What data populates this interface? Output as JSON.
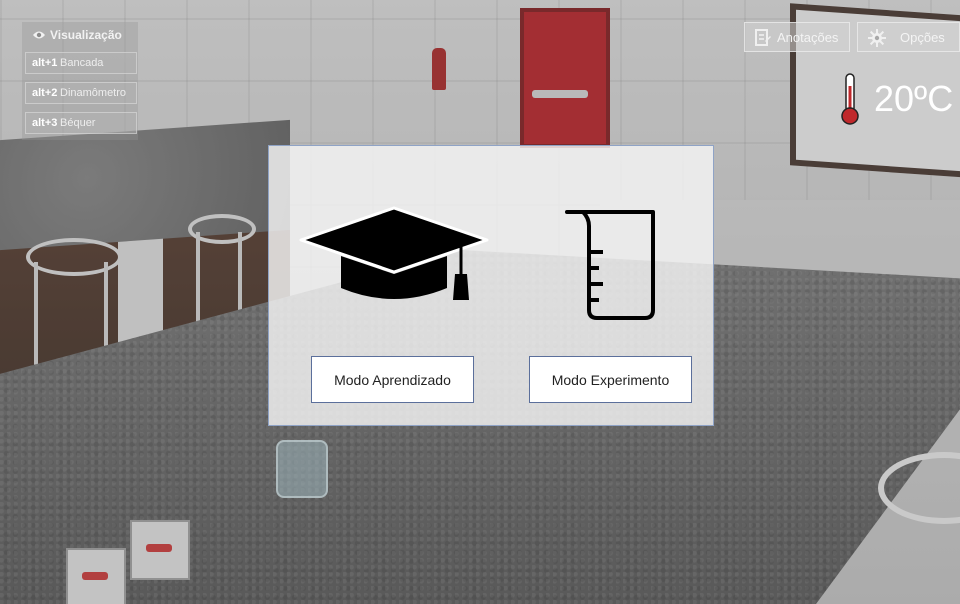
{
  "visualization": {
    "title": "Visualização",
    "shortcuts": [
      {
        "key": "alt+1",
        "label": "Bancada"
      },
      {
        "key": "alt+2",
        "label": "Dinamômetro"
      },
      {
        "key": "alt+3",
        "label": "Béquer"
      }
    ]
  },
  "toolbar": {
    "annotations_label": "Anotações",
    "options_label": "Opções"
  },
  "temperature": {
    "value": "20ºC"
  },
  "mode_dialog": {
    "learning_button": "Modo Aprendizado",
    "experiment_button": "Modo Experimento",
    "learning_icon": "graduation-cap-icon",
    "experiment_icon": "beaker-icon"
  },
  "colors": {
    "door": "#b2161c",
    "thermometer_bulb": "#c0282b",
    "modal_border": "#8fa3c6"
  }
}
